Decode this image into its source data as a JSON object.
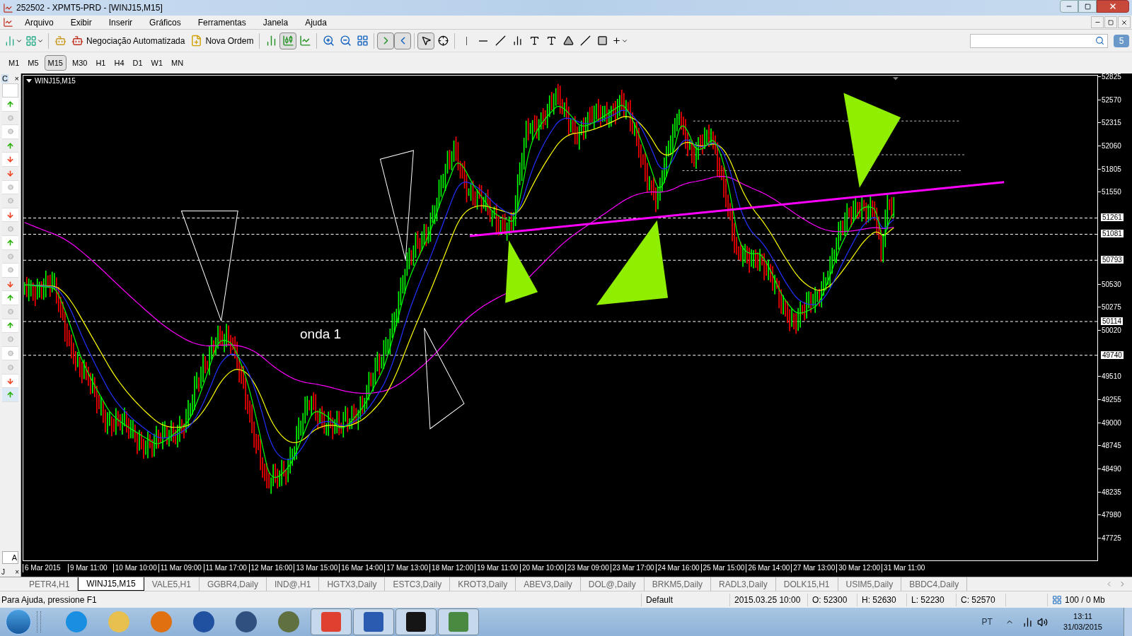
{
  "window": {
    "title": "252502 - XPMT5-PRD - [WINJ15,M15]"
  },
  "menu": [
    "Arquivo",
    "Exibir",
    "Inserir",
    "Gráficos",
    "Ferramentas",
    "Janela",
    "Ajuda"
  ],
  "toolbar": {
    "auto_trading": "Negociação Automatizada",
    "new_order": "Nova Ordem",
    "badge": "5"
  },
  "timeframes": [
    {
      "label": "M1",
      "selected": false
    },
    {
      "label": "M5",
      "selected": false
    },
    {
      "label": "M15",
      "selected": true
    },
    {
      "label": "M30",
      "selected": false
    },
    {
      "label": "H1",
      "selected": false
    },
    {
      "label": "H4",
      "selected": false
    },
    {
      "label": "D1",
      "selected": false
    },
    {
      "label": "W1",
      "selected": false
    },
    {
      "label": "MN",
      "selected": false
    }
  ],
  "signals_panel": {
    "header": "C",
    "close": "×",
    "footer_tab": "A",
    "bottom_label": "J",
    "bottom_close": "×",
    "items": [
      {
        "kind": "up"
      },
      {
        "kind": "neutral"
      },
      {
        "kind": "neutral"
      },
      {
        "kind": "up"
      },
      {
        "kind": "down"
      },
      {
        "kind": "down"
      },
      {
        "kind": "neutral"
      },
      {
        "kind": "neutral"
      },
      {
        "kind": "down"
      },
      {
        "kind": "neutral"
      },
      {
        "kind": "up"
      },
      {
        "kind": "neutral"
      },
      {
        "kind": "neutral"
      },
      {
        "kind": "down"
      },
      {
        "kind": "up"
      },
      {
        "kind": "neutral"
      },
      {
        "kind": "up"
      },
      {
        "kind": "neutral"
      },
      {
        "kind": "neutral"
      },
      {
        "kind": "neutral"
      },
      {
        "kind": "down"
      },
      {
        "kind": "up"
      }
    ]
  },
  "chart": {
    "symbol": "WINJ15,M15",
    "annotation": "onda 1",
    "price_ticks": [
      "52825",
      "52570",
      "52315",
      "52060",
      "51805",
      "51550",
      "50530",
      "50275",
      "50020",
      "49510",
      "49255",
      "49000",
      "48745",
      "48490",
      "48235",
      "47980",
      "47725"
    ],
    "levels": [
      "51261",
      "51081",
      "50793",
      "50114",
      "49740"
    ],
    "time_ticks": [
      "6 Mar 2015",
      "9 Mar 11:00",
      "10 Mar 10:00",
      "11 Mar 09:00",
      "11 Mar 17:00",
      "12 Mar 16:00",
      "13 Mar 15:00",
      "16 Mar 14:00",
      "17 Mar 13:00",
      "18 Mar 12:00",
      "19 Mar 11:00",
      "20 Mar 10:00",
      "23 Mar 09:00",
      "23 Mar 17:00",
      "24 Mar 16:00",
      "25 Mar 15:00",
      "26 Mar 14:00",
      "27 Mar 13:00",
      "30 Mar 12:00",
      "31 Mar 11:00"
    ]
  },
  "tabs": [
    {
      "label": "PETR4,H1",
      "selected": false
    },
    {
      "label": "WINJ15,M15",
      "selected": true
    },
    {
      "label": "VALE5,H1",
      "selected": false
    },
    {
      "label": "GGBR4,Daily",
      "selected": false
    },
    {
      "label": "IND@,H1",
      "selected": false
    },
    {
      "label": "HGTX3,Daily",
      "selected": false
    },
    {
      "label": "ESTC3,Daily",
      "selected": false
    },
    {
      "label": "KROT3,Daily",
      "selected": false
    },
    {
      "label": "ABEV3,Daily",
      "selected": false
    },
    {
      "label": "DOL@,Daily",
      "selected": false
    },
    {
      "label": "BRKM5,Daily",
      "selected": false
    },
    {
      "label": "RADL3,Daily",
      "selected": false
    },
    {
      "label": "DOLK15,H1",
      "selected": false
    },
    {
      "label": "USIM5,Daily",
      "selected": false
    },
    {
      "label": "BBDC4,Daily",
      "selected": false
    }
  ],
  "status_bar": {
    "help": "Para Ajuda, pressione F1",
    "profile": "Default",
    "datetime": "2015.03.25 10:00",
    "open": "O: 52300",
    "high": "H: 52630",
    "low": "L: 52230",
    "close": "C: 52570",
    "traffic": "100 / 0 Mb"
  },
  "taskbar": {
    "language": "PT",
    "time": "13:11",
    "date": "31/03/2015"
  }
}
